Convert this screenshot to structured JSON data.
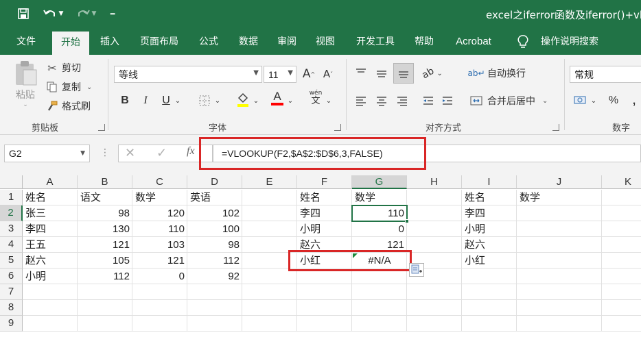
{
  "title_bar": {
    "title": "excel之iferror函数及iferror()+vlo",
    "qat": {
      "save_icon": "save-icon",
      "undo_icon": "undo-icon",
      "redo_icon": "redo-icon",
      "customize_icon": "customize-qat-icon"
    }
  },
  "tabs": [
    "文件",
    "开始",
    "插入",
    "页面布局",
    "公式",
    "数据",
    "审阅",
    "视图",
    "开发工具",
    "帮助",
    "Acrobat",
    "操作说明搜索"
  ],
  "active_tab": "开始",
  "ribbon": {
    "clipboard": {
      "paste": "粘贴",
      "cut": "剪切",
      "copy": "复制",
      "format_painter": "格式刷",
      "label": "剪贴板"
    },
    "font": {
      "font_name": "等线",
      "font_size": "11",
      "bold": "B",
      "italic": "I",
      "underline": "U",
      "font_color_glyph": "A",
      "phonetic": "wén",
      "label": "字体"
    },
    "alignment": {
      "wrap_text": "自动换行",
      "merge_center": "合并后居中",
      "label": "对齐方式"
    },
    "number": {
      "format": "常规",
      "percent": "%",
      "comma": ",",
      "label": "数字"
    }
  },
  "formula_bar": {
    "name_box": "G2",
    "fx": "fx",
    "formula": "=VLOOKUP(F2,$A$2:$D$6,3,FALSE)"
  },
  "sheet": {
    "columns": [
      "A",
      "B",
      "C",
      "D",
      "E",
      "F",
      "G",
      "H",
      "I",
      "J",
      "K"
    ],
    "rows": [
      "1",
      "2",
      "3",
      "4",
      "5",
      "6",
      "7",
      "8",
      "9"
    ],
    "selected_cell": "G2",
    "table1_header": [
      "姓名",
      "语文",
      "数学",
      "英语"
    ],
    "table1_rows": [
      [
        "张三",
        "98",
        "120",
        "102"
      ],
      [
        "李四",
        "130",
        "110",
        "100"
      ],
      [
        "王五",
        "121",
        "103",
        "98"
      ],
      [
        "赵六",
        "105",
        "121",
        "112"
      ],
      [
        "小明",
        "112",
        "0",
        "92"
      ]
    ],
    "table2_header": [
      "姓名",
      "数学"
    ],
    "table2_rows": [
      [
        "李四",
        "110"
      ],
      [
        "小明",
        "0"
      ],
      [
        "赵六",
        "121"
      ],
      [
        "小红",
        "#N/A"
      ]
    ],
    "table3_header": [
      "姓名",
      "数学"
    ],
    "table3_names": [
      "李四",
      "小明",
      "赵六",
      "小红"
    ]
  },
  "colors": {
    "excel_green": "#217346",
    "highlight_red": "#d92626"
  }
}
